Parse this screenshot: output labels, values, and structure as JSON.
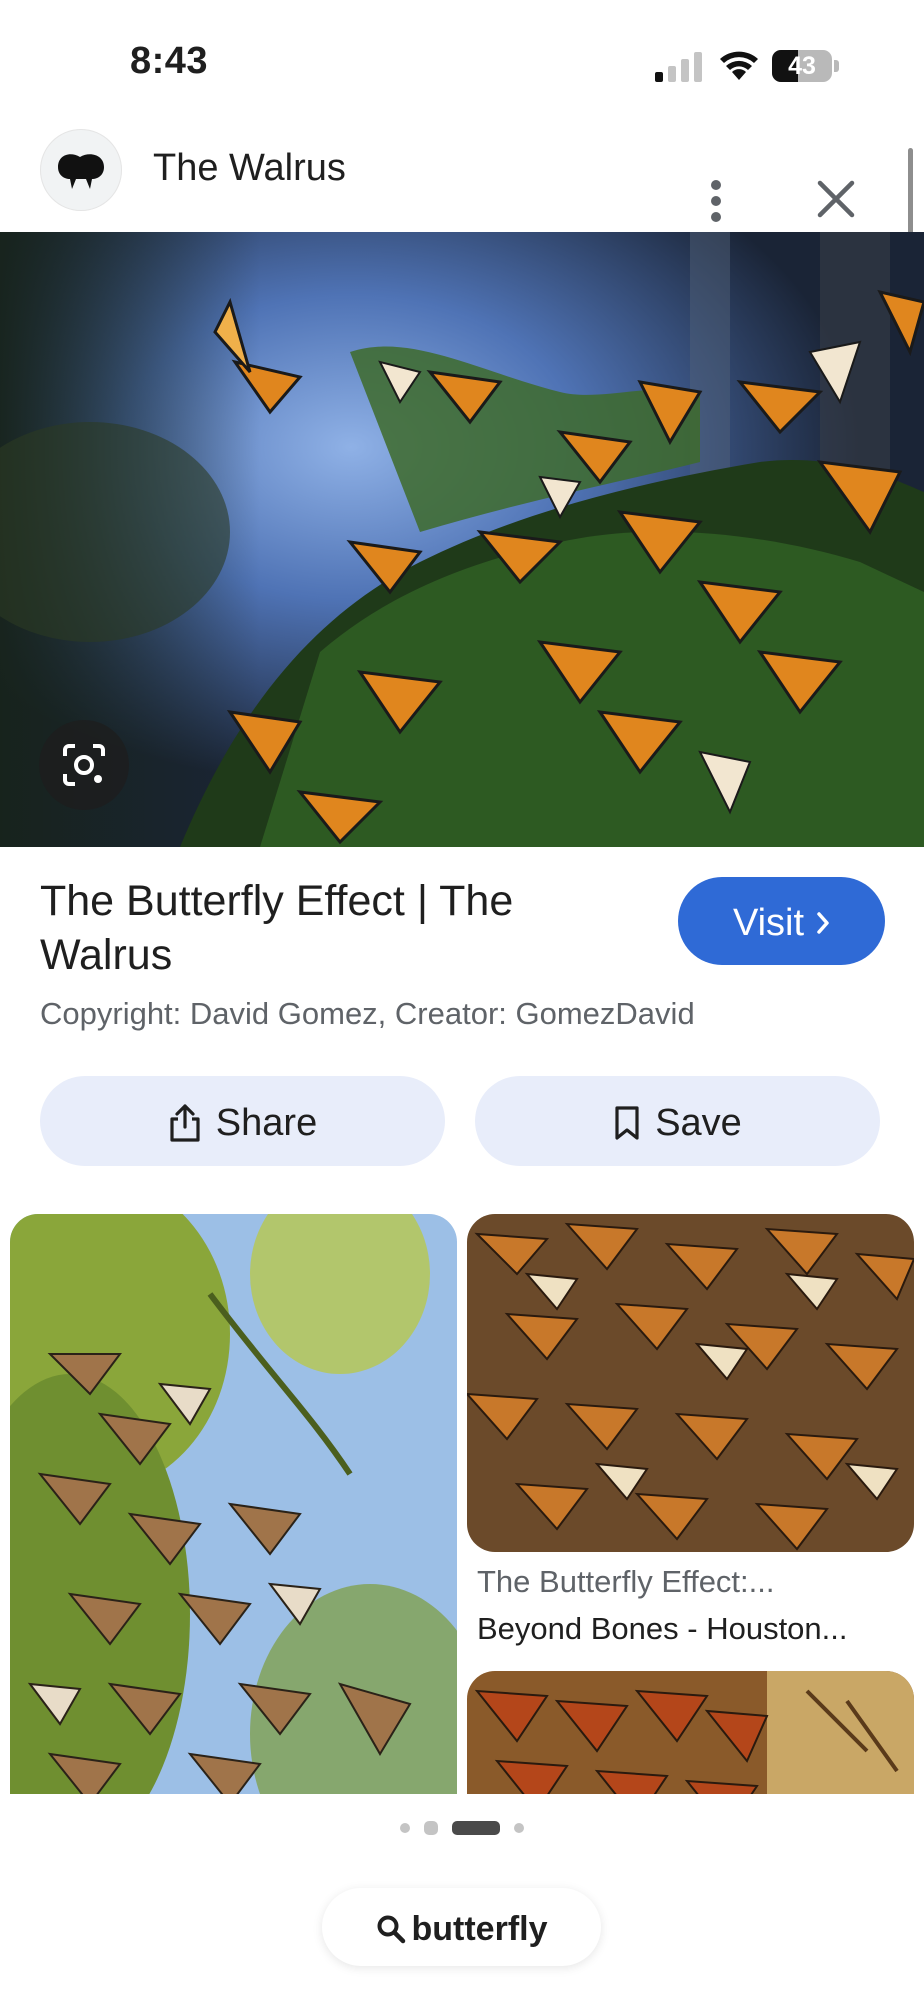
{
  "status_bar": {
    "time": "8:43",
    "battery_percent": "43",
    "battery_level": 0.43
  },
  "header": {
    "site_name": "The Walrus"
  },
  "result": {
    "title": "The Butterfly Effect | The Walrus",
    "credit": "Copyright: David Gomez, Creator: GomezDavid",
    "visit_label": "Visit",
    "share_label": "Share",
    "save_label": "Save",
    "accent_color": "#2f6ad6",
    "chip_color": "#e8edfa"
  },
  "related": {
    "items": [
      {
        "source": "",
        "title": ""
      },
      {
        "source": "The Butterfly Effect:...",
        "title": "Beyond Bones - Houston..."
      },
      {
        "source": "",
        "title": ""
      }
    ]
  },
  "pager": {
    "page_count": 4,
    "active_index": 2
  },
  "search": {
    "query": "butterfly"
  },
  "icons": [
    "walrus-logo-icon",
    "more-vert-icon",
    "close-icon",
    "lens-icon",
    "chevron-right-icon",
    "share-icon",
    "bookmark-icon",
    "search-icon",
    "signal-icon",
    "wifi-icon",
    "battery-icon"
  ]
}
